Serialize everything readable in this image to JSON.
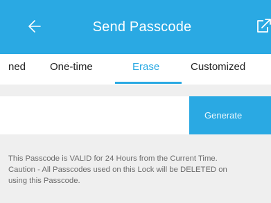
{
  "header": {
    "title": "Send Passcode",
    "back_icon": "arrow-left-icon",
    "share_icon": "share-icon",
    "background_color": "#2aa9e3"
  },
  "tabs": {
    "items": [
      {
        "label": "ned"
      },
      {
        "label": "One-time"
      },
      {
        "label": "Erase",
        "active": true
      },
      {
        "label": "Customized"
      }
    ],
    "active_color": "#2aa9e3"
  },
  "passcode": {
    "value": "",
    "placeholder": "",
    "generate_label": "Generate"
  },
  "info": {
    "line1": "This Passcode is VALID for 24 Hours from the Current Time.",
    "line2": "Caution - All Passcodes used on this Lock will be DELETED on",
    "line3": "using this Passcode."
  }
}
